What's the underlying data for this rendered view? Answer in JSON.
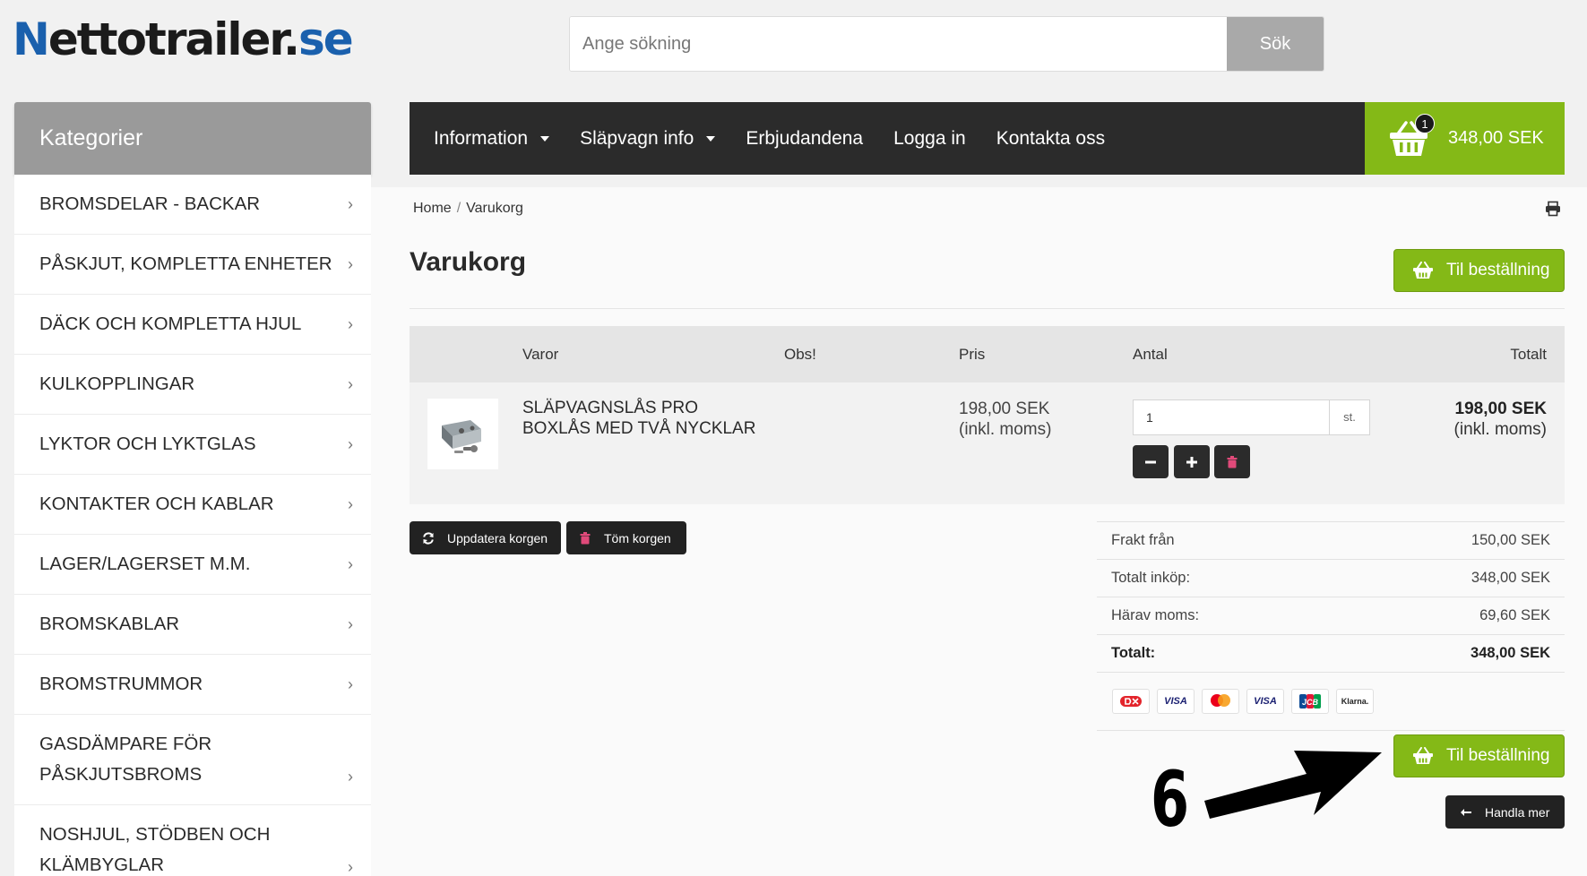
{
  "logo": {
    "part1": "N",
    "part2": "ettotrailer",
    "part3": ".",
    "part4": "se"
  },
  "search": {
    "placeholder": "Ange sökning",
    "button": "Sök"
  },
  "sidebar": {
    "title": "Kategorier",
    "items": [
      {
        "label": "BROMSDELAR - BACKAR"
      },
      {
        "label": "PÅSKJUT, KOMPLETTA ENHETER"
      },
      {
        "label": "DÄCK OCH KOMPLETTA HJUL"
      },
      {
        "label": "KULKOPPLINGAR"
      },
      {
        "label": "LYKTOR OCH LYKTGLAS"
      },
      {
        "label": "KONTAKTER OCH KABLAR"
      },
      {
        "label": "LAGER/LAGERSET M.M."
      },
      {
        "label": "BROMSKABLAR"
      },
      {
        "label": "BROMSTRUMMOR"
      },
      {
        "line1": "GASDÄMPARE FÖR",
        "line2": "PÅSKJUTSBROMS"
      },
      {
        "line1": "NOSHJUL, STÖDBEN OCH",
        "line2": "KLÄMBYGLAR"
      }
    ]
  },
  "nav": {
    "items": [
      "Information",
      "Släpvagn info",
      "Erbjudandena",
      "Logga in",
      "Kontakta oss"
    ],
    "cart_count": "1",
    "cart_total": "348,00 SEK"
  },
  "breadcrumb": {
    "home": "Home",
    "sep": "/",
    "current": "Varukorg"
  },
  "page": {
    "title": "Varukorg",
    "checkout_label": "Til beställning"
  },
  "table": {
    "headers": {
      "items": "Varor",
      "note": "Obs!",
      "price": "Pris",
      "qty": "Antal",
      "total": "Totalt"
    },
    "row": {
      "name_line1": "SLÄPVAGNSLÅS PRO",
      "name_line2": "BOXLÅS MED TVÅ NYCKLAR",
      "price": "198,00 SEK",
      "price_note": "(inkl. moms)",
      "qty": "1",
      "unit": "st.",
      "total": "198,00 SEK",
      "total_note": "(inkl. moms)"
    }
  },
  "actions": {
    "update": "Uppdatera korgen",
    "empty": "Töm korgen",
    "continue": "Handla mer"
  },
  "summary": {
    "rows": [
      {
        "label": "Frakt från",
        "value": "150,00 SEK"
      },
      {
        "label": "Totalt inköp:",
        "value": "348,00 SEK"
      },
      {
        "label": "Härav moms:",
        "value": "69,60 SEK"
      },
      {
        "label": "Totalt:",
        "value": "348,00 SEK"
      }
    ],
    "payment_icons": [
      "dankort-icon",
      "visa-electron-icon",
      "mastercard-icon",
      "visa-icon",
      "jcb-icon",
      "klarna-icon"
    ],
    "payment_labels": {
      "visa_electron": "VISA",
      "visa": "VISA",
      "jcb": "JCB",
      "klarna": "Klarna."
    }
  },
  "annotation": {
    "number": "6"
  },
  "colors": {
    "green": "#84b917",
    "dark": "#2b2b2b",
    "brand_blue": "#1a60ad"
  }
}
